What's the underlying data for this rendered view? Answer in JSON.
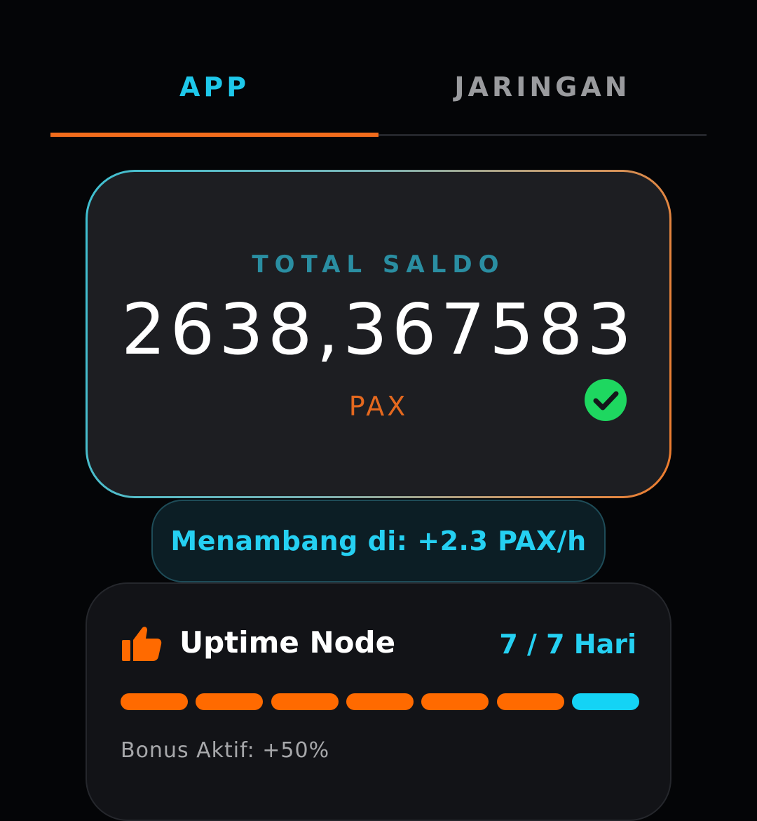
{
  "tabs": [
    {
      "label": "APP",
      "active": true
    },
    {
      "label": "JARINGAN",
      "active": false
    }
  ],
  "balance": {
    "label": "TOTAL SALDO",
    "value": "2638,367583",
    "unit": "PAX",
    "status_icon": "verified-check-icon"
  },
  "mining": {
    "text": "Menambang di: +2.3 PAX/h"
  },
  "uptime": {
    "icon": "thumbs-up-icon",
    "title": "Uptime Node",
    "days_text": "7 / 7 Hari",
    "completed_days": 7,
    "total_days": 7,
    "bonus_text": "Bonus Aktif: +50%"
  },
  "colors": {
    "accent_cyan": "#1ec8ea",
    "accent_orange": "#f26c1c",
    "progress_orange": "#ff6a00",
    "progress_cyan": "#14d3f5",
    "success_green": "#1ed760",
    "background": "#040507"
  }
}
